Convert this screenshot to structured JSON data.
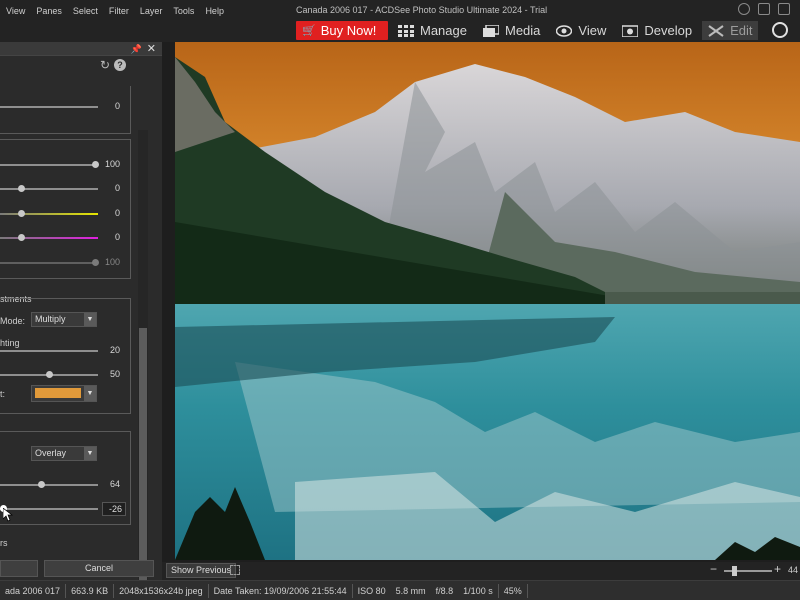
{
  "menu": [
    "View",
    "Panes",
    "Select",
    "Filter",
    "Layer",
    "Tools",
    "Help"
  ],
  "window_title": "Canada 2006 017 - ACDSee Photo Studio Ultimate 2024 - Trial",
  "modes": {
    "buy_now": "Buy Now!",
    "manage": "Manage",
    "media": "Media",
    "view": "View",
    "develop": "Develop",
    "edit": "Edit"
  },
  "panel": {
    "top_slider_value": "0",
    "group1": {
      "values": [
        "100",
        "0",
        "0",
        "0",
        "100"
      ]
    },
    "group2": {
      "title": "stments",
      "mode_label": "Mode:",
      "mode_value": "Multiply",
      "lighting_label": "hting",
      "lighting_value": "20",
      "second_value": "50",
      "color_label": "t:",
      "color": "#e19a3a"
    },
    "group3": {
      "mode_value": "Overlay",
      "value1": "64",
      "value2": "-26"
    },
    "footer_label": "rs",
    "cancel": "Cancel"
  },
  "image_toolbar": {
    "show_previous": "Show Previous",
    "zoom_level": "44"
  },
  "status": {
    "filename": "ada 2006 017",
    "filesize": "663.9 KB",
    "dimensions": "2048x1536x24b jpeg",
    "date_taken": "Date Taken: 19/09/2006 21:55:44",
    "iso": "ISO 80",
    "focal": "5.8 mm",
    "aperture": "f/8.8",
    "shutter": "1/100 s",
    "zoom": "45%"
  },
  "colors": {
    "buy_now": "#e02020",
    "sky": "#d47a20",
    "lake": "#2e9aa8",
    "forest": "#1f3320",
    "mountain": "#b9b9c3"
  }
}
